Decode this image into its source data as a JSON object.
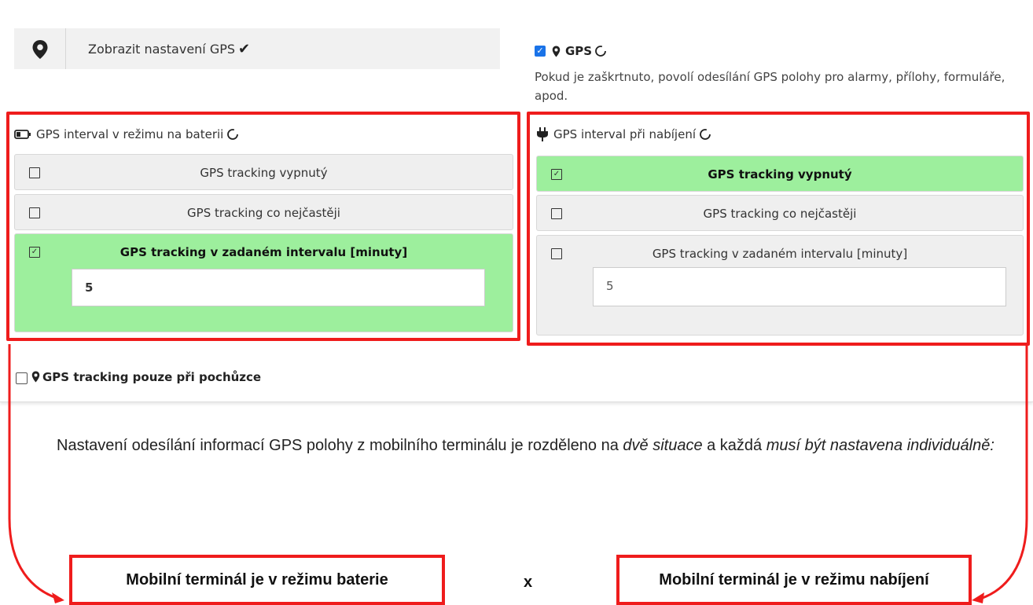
{
  "display_row": {
    "label": "Zobrazit nastavení GPS",
    "check": "✔",
    "icon": "map-pin-icon"
  },
  "gps": {
    "label": "GPS",
    "checked": true,
    "description": "Pokud je zaškrtnuto, povolí odesílání GPS polohy pro alarmy, přílohy, formuláře, apod."
  },
  "battery_panel": {
    "title": "GPS interval v režimu na baterii",
    "icon": "battery-icon",
    "options": [
      {
        "label": "GPS tracking vypnutý",
        "checked": false
      },
      {
        "label": "GPS tracking co nejčastěji",
        "checked": false
      },
      {
        "label": "GPS tracking v zadaném intervalu [minuty]",
        "checked": true,
        "value": "5"
      }
    ]
  },
  "charging_panel": {
    "title": "GPS interval při nabíjení",
    "icon": "plug-icon",
    "options": [
      {
        "label": "GPS tracking vypnutý",
        "checked": true
      },
      {
        "label": "GPS tracking co nejčastěji",
        "checked": false
      },
      {
        "label": "GPS tracking v zadaném intervalu [minuty]",
        "checked": false,
        "value": "5"
      }
    ]
  },
  "walk_only": {
    "label": "GPS tracking pouze při pochůzce",
    "checked": false
  },
  "paragraph": {
    "p1": "Nastavení odesílání informací GPS polohy z mobilního terminálu je rozděleno na ",
    "em1": "dvě situace",
    "p2": " a každá ",
    "em2": "musí být nastavena individuálně:"
  },
  "bottom": {
    "battery_label": "Mobilní terminál je v režimu baterie",
    "separator": "x",
    "charging_label": "Mobilní terminál je v režimu nabíjení"
  },
  "colors": {
    "accent_red": "#ef1c1c",
    "active_green": "#9def9d",
    "checkbox_blue": "#1a73e8"
  }
}
